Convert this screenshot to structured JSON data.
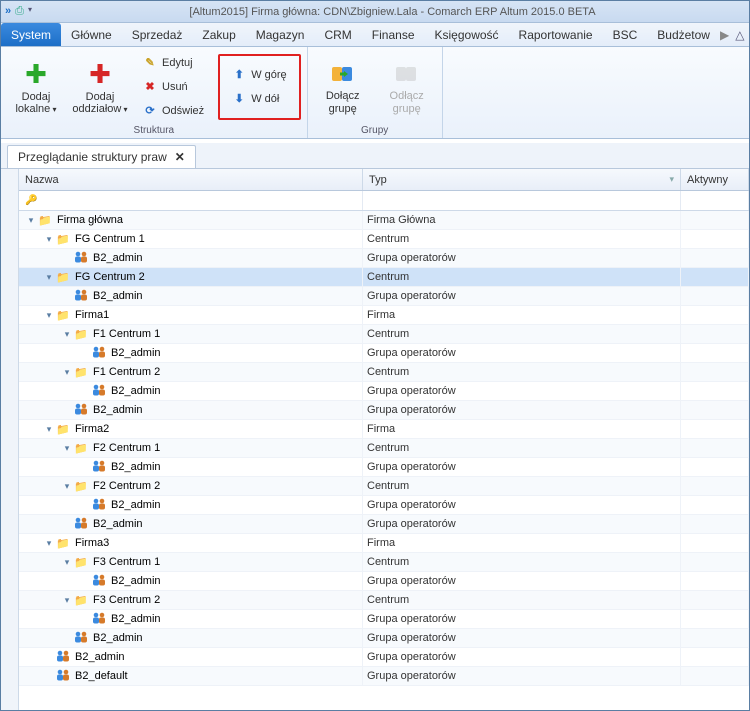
{
  "window": {
    "title": "[Altum2015] Firma główna: CDN\\Zbigniew.Lala - Comarch ERP Altum 2015.0 BETA"
  },
  "menu": {
    "tabs": [
      "System",
      "Główne",
      "Sprzedaż",
      "Zakup",
      "Magazyn",
      "CRM",
      "Finanse",
      "Księgowość",
      "Raportowanie",
      "BSC",
      "Budżetow"
    ],
    "active": 0
  },
  "ribbon": {
    "dodaj_lokalne": "Dodaj lokalne",
    "dodaj_oddzialowo": "Dodaj oddziałow",
    "edytuj": "Edytuj",
    "usun": "Usuń",
    "odswiez": "Odśwież",
    "w_gore": "W górę",
    "w_dol": "W dół",
    "dolacz": "Dołącz grupę",
    "odlacz": "Odłącz grupę",
    "grp_struktura": "Struktura",
    "grp_grupy": "Grupy"
  },
  "doc": {
    "tab_title": "Przeglądanie struktury praw",
    "close": "✕"
  },
  "grid": {
    "col_nazwa": "Nazwa",
    "col_typ": "Typ",
    "col_aktywny": "Aktywny"
  },
  "types": {
    "firma_glowna": "Firma Główna",
    "centrum": "Centrum",
    "grupa": "Grupa operatorów",
    "firma": "Firma"
  },
  "tree": [
    {
      "indent": 0,
      "expand": "open",
      "icon": "folder",
      "name": "Firma główna",
      "typeKey": "firma_glowna"
    },
    {
      "indent": 1,
      "expand": "open",
      "icon": "folder",
      "name": "FG Centrum 1",
      "typeKey": "centrum"
    },
    {
      "indent": 2,
      "expand": "none",
      "icon": "users",
      "name": "B2_admin",
      "typeKey": "grupa"
    },
    {
      "indent": 1,
      "expand": "open",
      "icon": "folder",
      "name": "FG Centrum 2",
      "typeKey": "centrum",
      "selected": true,
      "marker": true
    },
    {
      "indent": 2,
      "expand": "none",
      "icon": "users",
      "name": "B2_admin",
      "typeKey": "grupa"
    },
    {
      "indent": 1,
      "expand": "open",
      "icon": "folder",
      "name": "Firma1",
      "typeKey": "firma"
    },
    {
      "indent": 2,
      "expand": "open",
      "icon": "folder",
      "name": "F1 Centrum 1",
      "typeKey": "centrum"
    },
    {
      "indent": 3,
      "expand": "none",
      "icon": "users",
      "name": "B2_admin",
      "typeKey": "grupa"
    },
    {
      "indent": 2,
      "expand": "open",
      "icon": "folder",
      "name": "F1 Centrum 2",
      "typeKey": "centrum"
    },
    {
      "indent": 3,
      "expand": "none",
      "icon": "users",
      "name": "B2_admin",
      "typeKey": "grupa"
    },
    {
      "indent": 2,
      "expand": "none",
      "icon": "users",
      "name": "B2_admin",
      "typeKey": "grupa"
    },
    {
      "indent": 1,
      "expand": "open",
      "icon": "folder",
      "name": "Firma2",
      "typeKey": "firma"
    },
    {
      "indent": 2,
      "expand": "open",
      "icon": "folder",
      "name": "F2 Centrum 1",
      "typeKey": "centrum"
    },
    {
      "indent": 3,
      "expand": "none",
      "icon": "users",
      "name": "B2_admin",
      "typeKey": "grupa"
    },
    {
      "indent": 2,
      "expand": "open",
      "icon": "folder",
      "name": "F2 Centrum 2",
      "typeKey": "centrum"
    },
    {
      "indent": 3,
      "expand": "none",
      "icon": "users",
      "name": "B2_admin",
      "typeKey": "grupa"
    },
    {
      "indent": 2,
      "expand": "none",
      "icon": "users",
      "name": "B2_admin",
      "typeKey": "grupa"
    },
    {
      "indent": 1,
      "expand": "open",
      "icon": "folder",
      "name": "Firma3",
      "typeKey": "firma"
    },
    {
      "indent": 2,
      "expand": "open",
      "icon": "folder",
      "name": "F3 Centrum 1",
      "typeKey": "centrum"
    },
    {
      "indent": 3,
      "expand": "none",
      "icon": "users",
      "name": "B2_admin",
      "typeKey": "grupa"
    },
    {
      "indent": 2,
      "expand": "open",
      "icon": "folder",
      "name": "F3 Centrum 2",
      "typeKey": "centrum"
    },
    {
      "indent": 3,
      "expand": "none",
      "icon": "users",
      "name": "B2_admin",
      "typeKey": "grupa"
    },
    {
      "indent": 2,
      "expand": "none",
      "icon": "users",
      "name": "B2_admin",
      "typeKey": "grupa"
    },
    {
      "indent": 1,
      "expand": "none",
      "icon": "users",
      "name": "B2_admin",
      "typeKey": "grupa"
    },
    {
      "indent": 1,
      "expand": "none",
      "icon": "users",
      "name": "B2_default",
      "typeKey": "grupa"
    }
  ]
}
